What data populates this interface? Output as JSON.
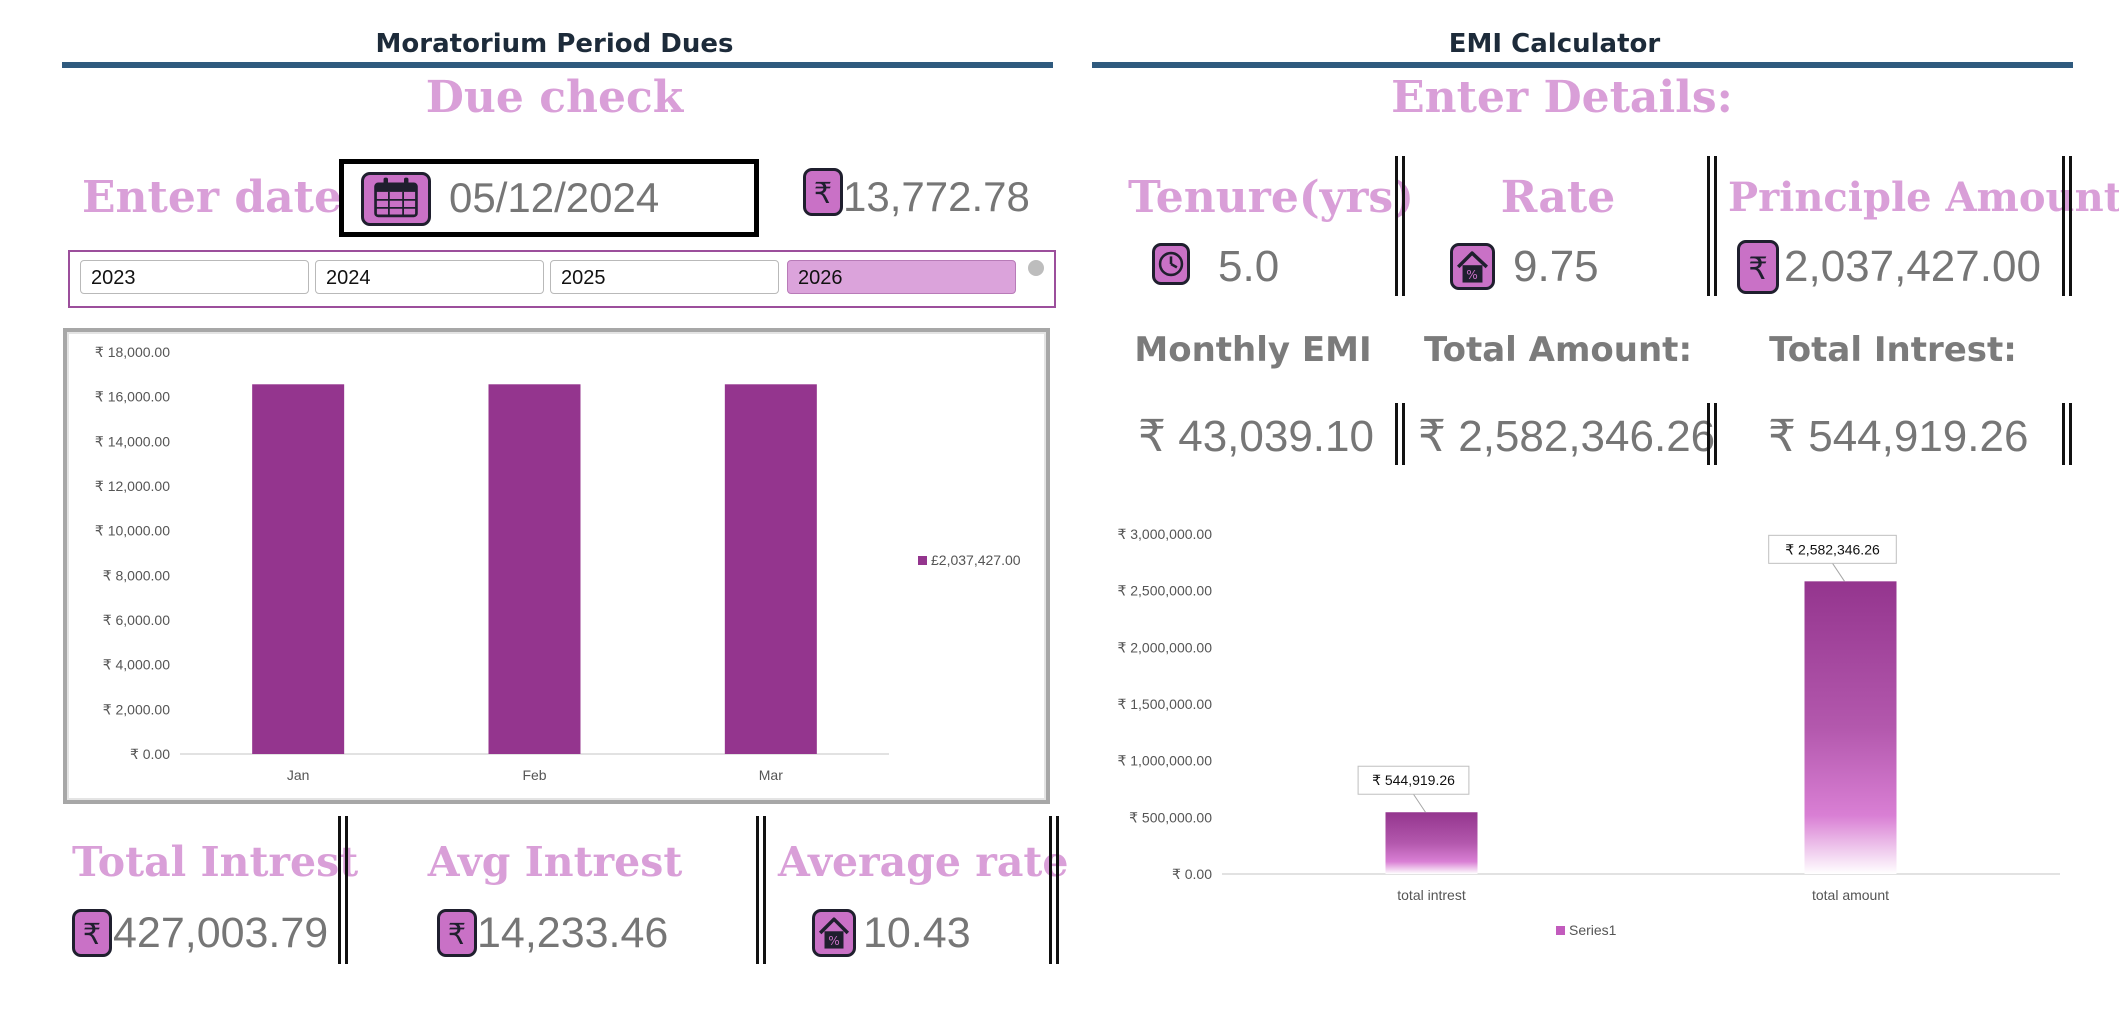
{
  "moratorium": {
    "title": "Moratorium Period  Dues",
    "due_check": "Due check",
    "enter_date_label": "Enter date :",
    "date_value": "05/12/2024",
    "due_amount": "13,772.78",
    "years": [
      {
        "label": "2023",
        "selected": false
      },
      {
        "label": "2024",
        "selected": false
      },
      {
        "label": "2025",
        "selected": false
      },
      {
        "label": "2026",
        "selected": true
      }
    ],
    "total_interest_label": "Total Intrest",
    "total_interest_value": "427,003.79",
    "avg_interest_label": "Avg Intrest",
    "avg_interest_value": "14,233.46",
    "average_rate_label": "Average rate",
    "average_rate_value": "10.43"
  },
  "emi": {
    "title": "EMI Calculator",
    "enter_details": "Enter Details:",
    "tenure_label": "Tenure(yrs)",
    "tenure_value": "5.0",
    "rate_label": "Rate",
    "rate_value": "9.75",
    "principal_label": "Principle Amount",
    "principal_value": "2,037,427.00",
    "monthly_emi_label": "Monthly EMI",
    "monthly_emi_value": "₹ 43,039.10",
    "total_amount_label": "Total  Amount:",
    "total_amount_value": "₹ 2,582,346.26",
    "total_interest_label": "Total Intrest:",
    "total_interest_value": "₹ 544,919.26"
  },
  "icons": {
    "date": "calendar-icon",
    "currency": "rupee-icon",
    "tenure": "clock-icon",
    "rate": "house-percent-icon"
  },
  "colors": {
    "accent_pink": "#d99fd8",
    "bar_purple": "#94358e",
    "header_rule": "#2f5a7e"
  },
  "chart_data": [
    {
      "type": "bar",
      "categories": [
        "Jan",
        "Feb",
        "Mar"
      ],
      "series": [
        {
          "name": "£2,037,427.00",
          "values": [
            16554,
            16554,
            16554
          ]
        }
      ],
      "ylim": [
        0,
        18000
      ],
      "yticks": [
        0,
        2000,
        4000,
        6000,
        8000,
        10000,
        12000,
        14000,
        16000,
        18000
      ],
      "ytick_labels": [
        "₹ 0.00",
        "₹ 2,000.00",
        "₹ 4,000.00",
        "₹ 6,000.00",
        "₹ 8,000.00",
        "₹ 10,000.00",
        "₹ 12,000.00",
        "₹ 14,000.00",
        "₹ 16,000.00",
        "₹ 18,000.00"
      ],
      "legend": "right",
      "grid": false
    },
    {
      "type": "bar",
      "categories": [
        "total intrest",
        "total amount"
      ],
      "series": [
        {
          "name": "Series1",
          "values": [
            544919.26,
            2582346.26
          ]
        }
      ],
      "data_labels": [
        "₹ 544,919.26",
        "₹ 2,582,346.26"
      ],
      "ylim": [
        0,
        3000000
      ],
      "yticks": [
        0,
        500000,
        1000000,
        1500000,
        2000000,
        2500000,
        3000000
      ],
      "ytick_labels": [
        "₹ 0.00",
        "₹ 500,000.00",
        "₹ 1,000,000.00",
        "₹ 1,500,000.00",
        "₹ 2,000,000.00",
        "₹ 2,500,000.00",
        "₹ 3,000,000.00"
      ],
      "legend": "bottom",
      "grid": false
    }
  ]
}
